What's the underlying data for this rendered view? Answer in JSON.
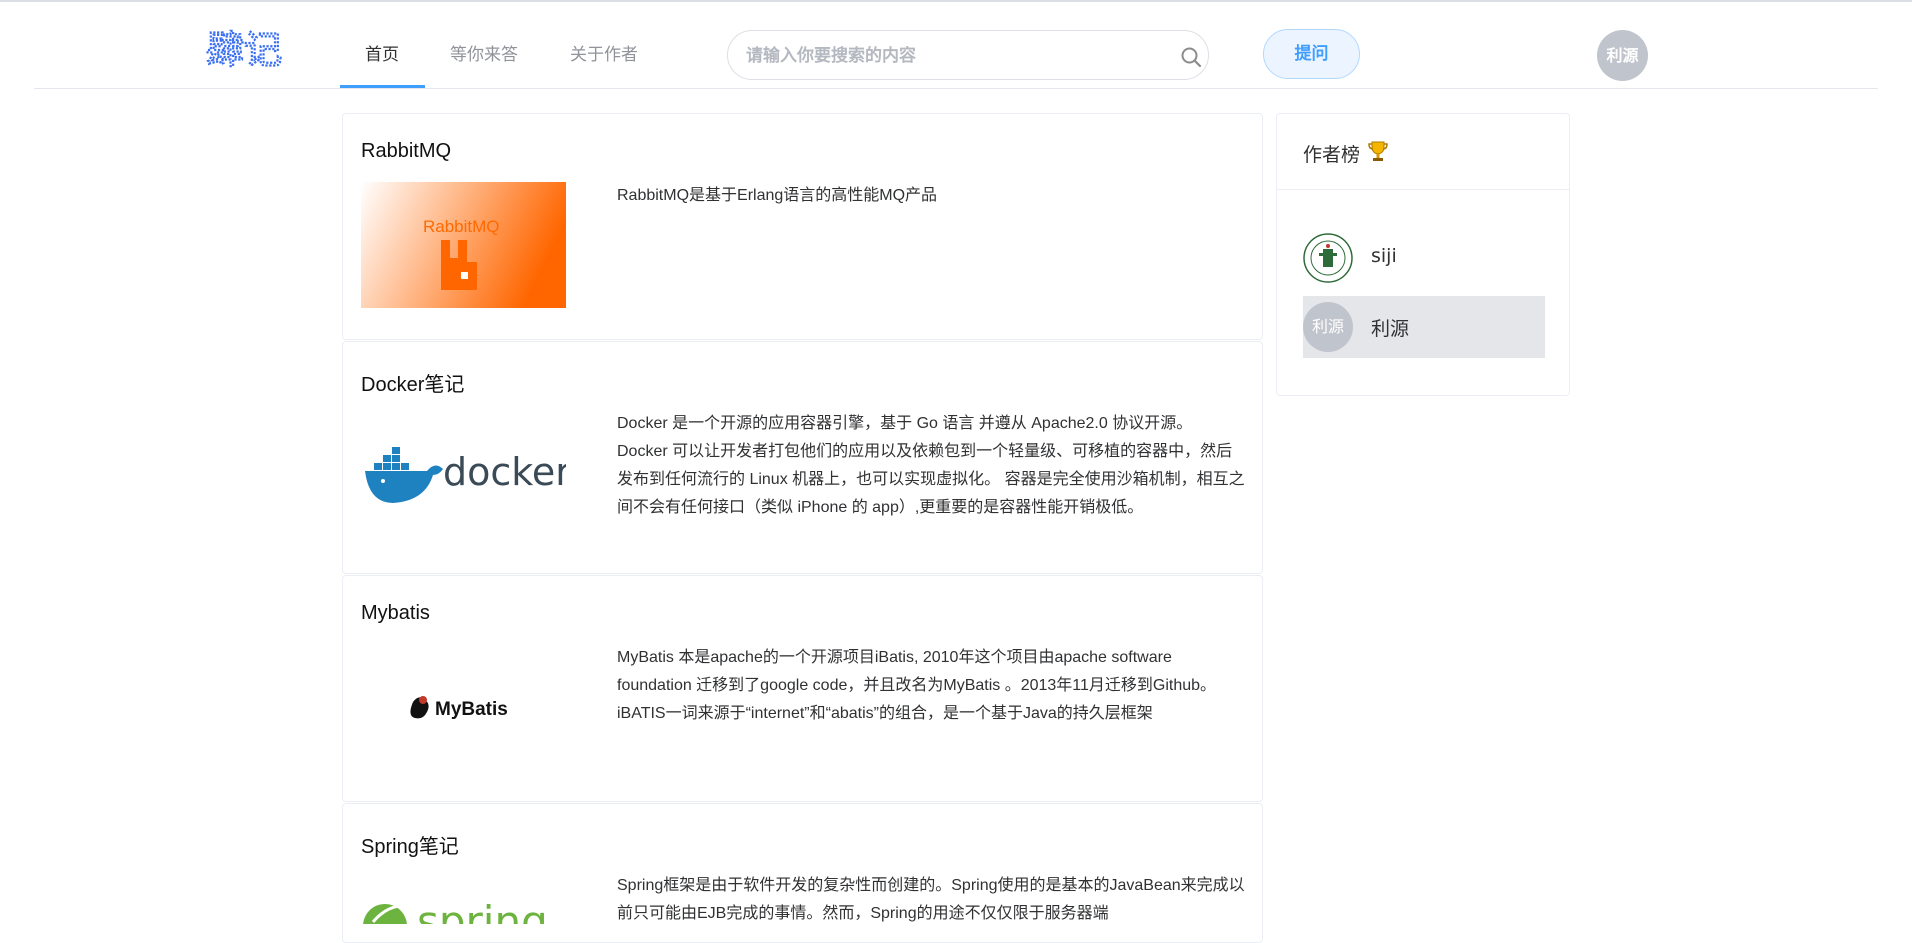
{
  "header": {
    "logo_text": "肆记",
    "nav": [
      {
        "label": "首页",
        "active": true
      },
      {
        "label": "等你来答",
        "active": false
      },
      {
        "label": "关于作者",
        "active": false
      }
    ],
    "search_placeholder": "请输入你要搜索的内容",
    "ask_label": "提问",
    "user_avatar_text": "利源",
    "accent_color": "#409eff"
  },
  "posts": [
    {
      "title": "RabbitMQ",
      "thumb_text": "RabbitMQ",
      "desc": "RabbitMQ是基于Erlang语言的高性能MQ产品"
    },
    {
      "title": "Docker笔记",
      "thumb_text": "docker",
      "desc": "Docker 是一个开源的应用容器引擎，基于 Go 语言 并遵从 Apache2.0 协议开源。 Docker 可以让开发者打包他们的应用以及依赖包到一个轻量级、可移植的容器中，然后发布到任何流行的 Linux 机器上，也可以实现虚拟化。 容器是完全使用沙箱机制，相互之间不会有任何接口（类似 iPhone 的 app）,更重要的是容器性能开销极低。"
    },
    {
      "title": "Mybatis",
      "thumb_text": "MyBatis",
      "desc": "MyBatis 本是apache的一个开源项目iBatis, 2010年这个项目由apache software foundation 迁移到了google code，并且改名为MyBatis 。2013年11月迁移到Github。iBATIS一词来源于“internet”和“abatis”的组合，是一个基于Java的持久层框架"
    },
    {
      "title": "Spring笔记",
      "thumb_text": "spring",
      "desc": "Spring框架是由于软件开发的复杂性而创建的。Spring使用的是基本的JavaBean来完成以前只可能由EJB完成的事情。然而，Spring的用途不仅仅限于服务器端"
    }
  ],
  "sidebar": {
    "title": "作者榜",
    "authors": [
      {
        "name": "siji",
        "avatar_text": ""
      },
      {
        "name": "利源",
        "avatar_text": "利源"
      }
    ]
  }
}
